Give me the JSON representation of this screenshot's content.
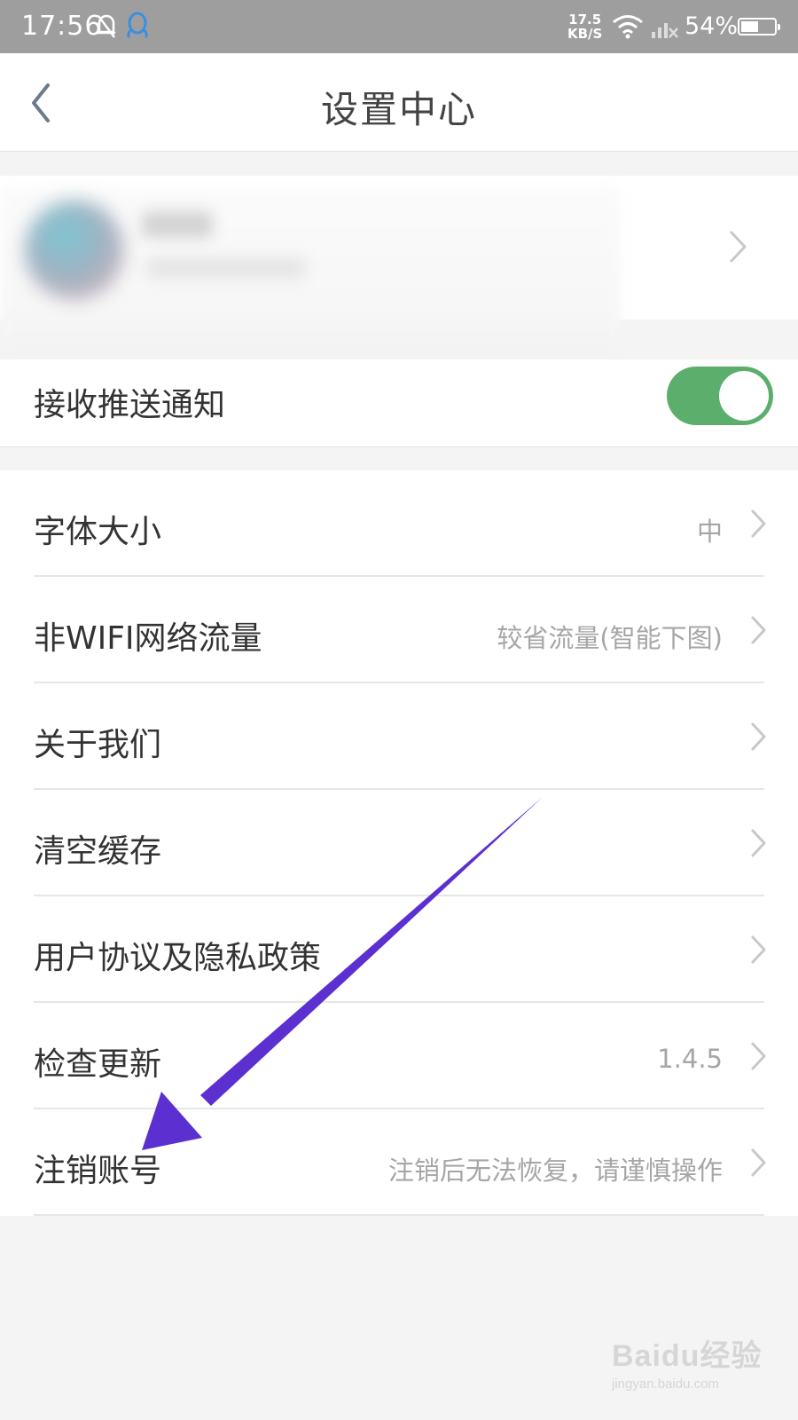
{
  "status_bar": {
    "time": "17:56",
    "net_speed_value": "17.5",
    "net_speed_unit": "KB/S",
    "battery_percent": "54%",
    "battery_level": 0.54,
    "icons": [
      "mute-bell-icon",
      "qq-penguin-icon",
      "wifi-icon",
      "cellular-signal-icon",
      "battery-icon"
    ]
  },
  "header": {
    "title": "设置中心",
    "back_icon": "chevron-left-icon"
  },
  "push": {
    "label": "接收推送通知",
    "enabled": true,
    "toggle_color": "#5cae6d"
  },
  "settings": [
    {
      "label": "字体大小",
      "value": "中"
    },
    {
      "label": "非WIFI网络流量",
      "value": "较省流量(智能下图)"
    },
    {
      "label": "关于我们",
      "value": ""
    },
    {
      "label": "清空缓存",
      "value": ""
    },
    {
      "label": "用户协议及隐私政策",
      "value": ""
    },
    {
      "label": "检查更新",
      "value": "1.4.5"
    },
    {
      "label": "注销账号",
      "value": "注销后无法恢复，请谨慎操作"
    }
  ],
  "annotation": {
    "arrow_color": "#5b2fd0"
  },
  "watermark": {
    "logo": "Baidu经验",
    "url": "jingyan.baidu.com"
  }
}
